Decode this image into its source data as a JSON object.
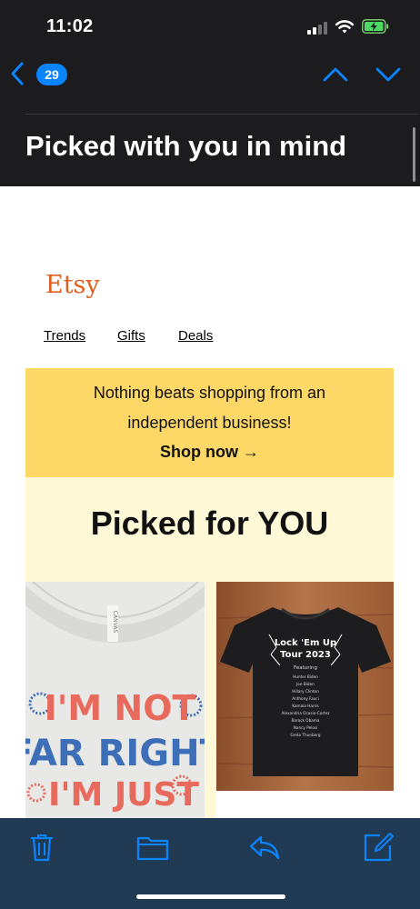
{
  "status": {
    "time": "11:02"
  },
  "nav": {
    "unread_count": "29"
  },
  "email": {
    "subject": "Picked with you in mind",
    "logo": "Etsy",
    "links": [
      "Trends",
      "Gifts",
      "Deals"
    ],
    "promo": {
      "line1": "Nothing beats shopping from an",
      "line2": "independent business!",
      "cta": "Shop now →"
    },
    "picked_title": "Picked for YOU",
    "products": [
      {
        "shirt_lines": [
          "I'M NOT",
          "FAR RIGHT",
          "I'M JUST"
        ],
        "tag": "CANVAS"
      },
      {
        "shirt_title": "Lock 'Em Up",
        "shirt_subtitle": "Tour 2023",
        "shirt_featuring": "Featuring",
        "shirt_names": [
          "Hunter Biden",
          "Joe Biden",
          "Hillary Clinton",
          "Anthony Fauci",
          "Kamala Harris",
          "Alexandria Ocasio-Cortez",
          "Barack Obama",
          "Nancy Pelosi",
          "Greta Thunberg"
        ]
      }
    ]
  },
  "colors": {
    "accent": "#0a84ff",
    "promo_bg": "#fdd866",
    "picked_bg": "#fff9d8",
    "etsy_orange": "#e05e1f"
  }
}
